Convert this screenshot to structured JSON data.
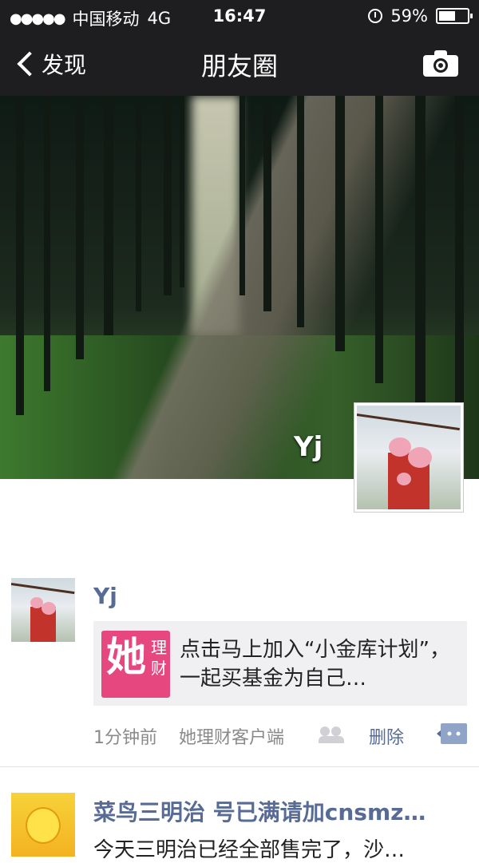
{
  "status_bar": {
    "signal": "●●●●●",
    "carrier": "中国移动",
    "network": "4G",
    "time": "16:47",
    "battery": "59%",
    "battery_level": 0.59
  },
  "nav": {
    "back_label": "发现",
    "title": "朋友圈"
  },
  "cover": {
    "profile_name": "Yj"
  },
  "posts": [
    {
      "author": "Yj",
      "share": {
        "logo_big": "她",
        "logo_small": "理财",
        "text": "点击马上加入“小金库计划”，一起买基金为自己…"
      },
      "time": "1分钟前",
      "source": "她理财客户端",
      "delete_label": "删除"
    },
    {
      "author": "菜鸟三明治 号已满请加cnsmz…",
      "text": "今天三明治已经全部售完了，沙…"
    }
  ],
  "colors": {
    "bar": "#1e1e20",
    "link": "#576b95",
    "share_bg": "#f0f0f3",
    "logo": "#e5477e"
  }
}
